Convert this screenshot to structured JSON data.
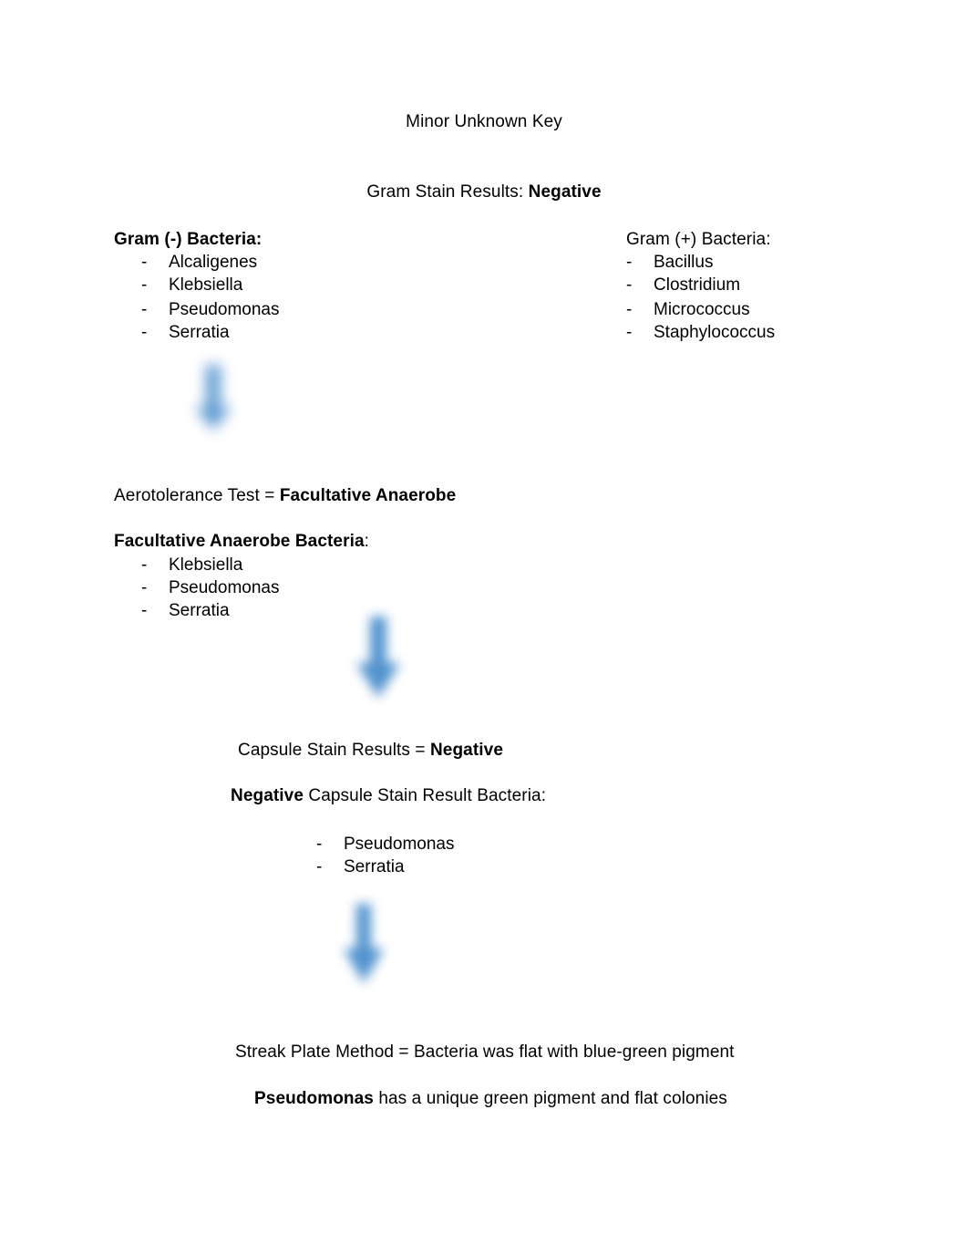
{
  "document": {
    "title": "Minor Unknown Key",
    "accent_color": "#4a8fcc",
    "text_color": "#000000",
    "background_color": "#ffffff"
  },
  "gram_stain": {
    "result_line_label": "Gram Stain Results: ",
    "result_line_value": "Negative",
    "negative_heading": "Gram (-) Bacteria:",
    "negative_list": [
      "Alcaligenes",
      "Klebsiella",
      "Pseudomonas",
      "Serratia"
    ],
    "positive_heading": "Gram (+) Bacteria:",
    "positive_list": [
      "Bacillus",
      "Clostridium",
      "Micrococcus",
      "Staphylococcus"
    ]
  },
  "aerotolerance": {
    "result_line_label": "Aerotolerance Test = ",
    "result_line_value": "Facultative Anaerobe",
    "heading_bold": "Facultative Anaerobe Bacteria",
    "heading_tail": ":",
    "list": [
      "Klebsiella",
      "Pseudomonas",
      "Serratia"
    ]
  },
  "capsule_stain": {
    "result_line_label": "Capsule Stain Results = ",
    "result_line_value": "Negative",
    "heading_bold": "Negative",
    "heading_tail": " Capsule Stain Result Bacteria:",
    "list": [
      "Pseudomonas",
      "Serratia"
    ]
  },
  "streak_plate": {
    "result_line": "Streak Plate Method = Bacteria was flat with blue-green pigment",
    "conclusion_bold": "Pseudomonas",
    "conclusion_tail": " has a unique green pigment and flat colonies"
  },
  "arrows": [
    {
      "name": "down-arrow-icon",
      "label": "down arrow"
    },
    {
      "name": "down-arrow-icon",
      "label": "down arrow"
    },
    {
      "name": "down-arrow-icon",
      "label": "down arrow"
    }
  ],
  "bullet_marker": "-"
}
